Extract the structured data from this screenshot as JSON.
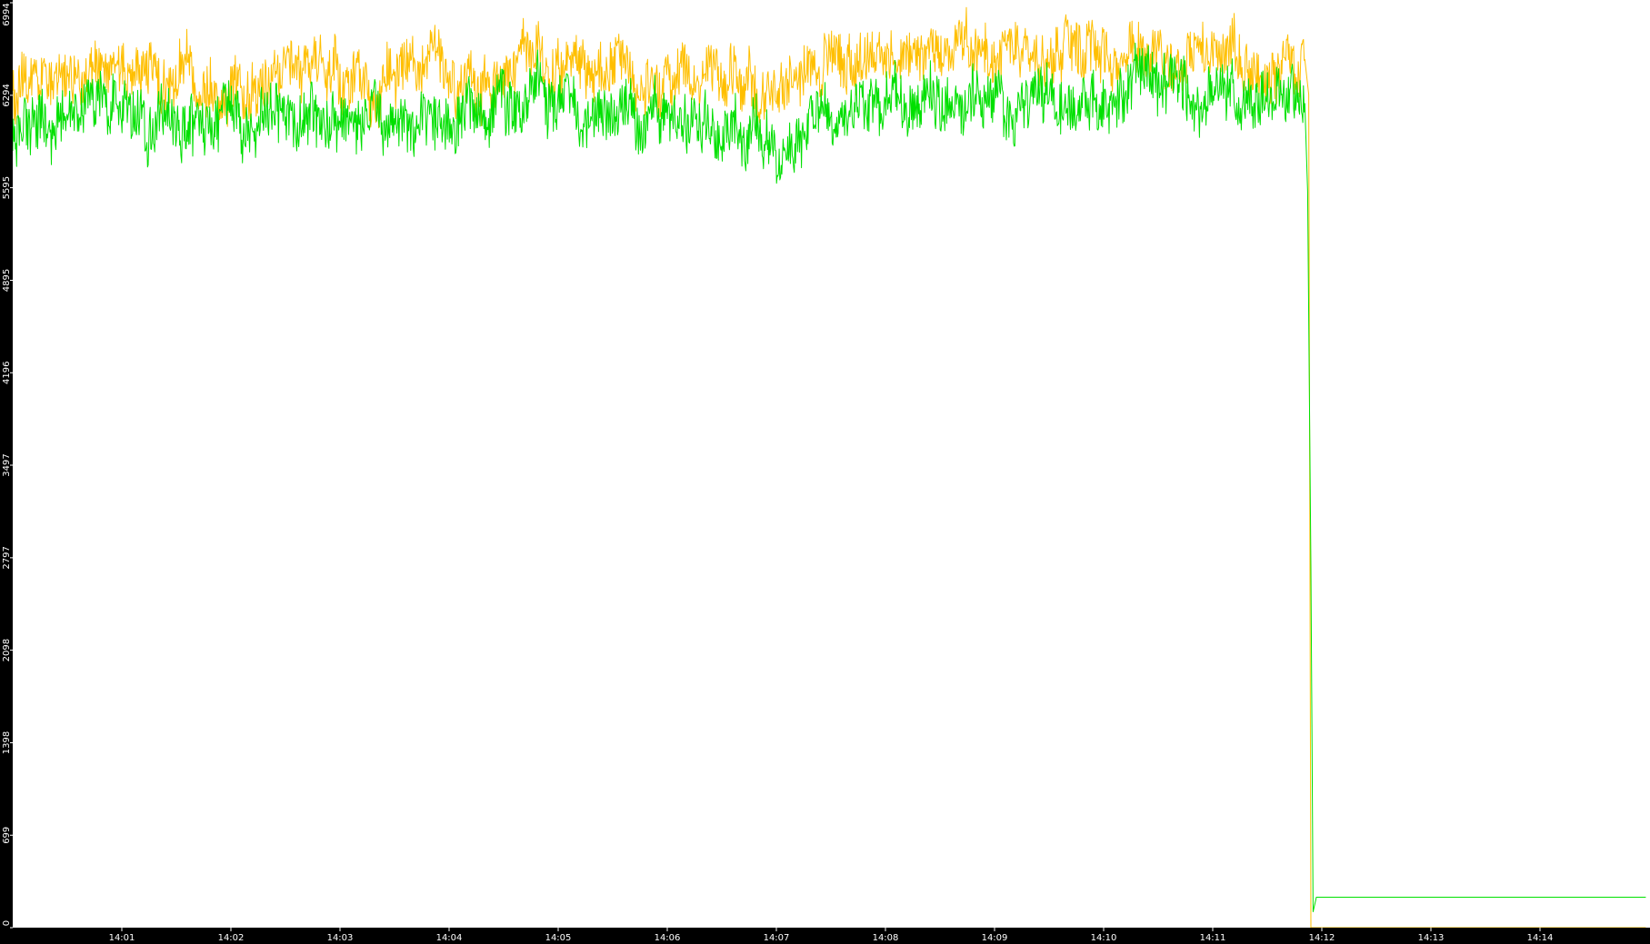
{
  "chart_data": {
    "type": "line",
    "title": "",
    "xlabel": "",
    "ylabel": "",
    "y_ticks": [
      "0",
      "699",
      "1398",
      "2098",
      "2797",
      "3497",
      "4196",
      "4895",
      "5595",
      "6294",
      "6994"
    ],
    "x_ticks": [
      "14:01",
      "14:02",
      "14:03",
      "14:04",
      "14:05",
      "14:06",
      "14:07",
      "14:08",
      "14:09",
      "14:10",
      "14:11",
      "14:12",
      "14:13",
      "14:14"
    ],
    "ylim": [
      0,
      6994
    ],
    "x_range_minutes": [
      0.0,
      14.97
    ],
    "grid": false,
    "legend": "none",
    "colors": {
      "background": "#ffffff",
      "axis_band": "#000000",
      "tick_text": "#ffffff",
      "series_orange": "#ffbf00",
      "series_green": "#00e000"
    },
    "series": [
      {
        "key": "orange",
        "color": "#ffbf00",
        "points": [
          [
            0.0,
            6300
          ],
          [
            0.5,
            6460
          ],
          [
            1.0,
            6480
          ],
          [
            1.5,
            6420
          ],
          [
            2.0,
            6430
          ],
          [
            2.5,
            6480
          ],
          [
            3.0,
            6400
          ],
          [
            3.5,
            6470
          ],
          [
            4.0,
            6380
          ],
          [
            4.5,
            6470
          ],
          [
            4.8,
            6600
          ],
          [
            5.0,
            6480
          ],
          [
            5.5,
            6460
          ],
          [
            6.0,
            6390
          ],
          [
            6.5,
            6420
          ],
          [
            6.9,
            6300
          ],
          [
            7.0,
            6350
          ],
          [
            7.5,
            6470
          ],
          [
            8.0,
            6650
          ],
          [
            8.5,
            6620
          ],
          [
            9.0,
            6580
          ],
          [
            9.5,
            6620
          ],
          [
            10.0,
            6650
          ],
          [
            10.5,
            6640
          ],
          [
            11.0,
            6580
          ],
          [
            11.5,
            6520
          ],
          [
            11.85,
            6520
          ],
          [
            11.88,
            6300
          ],
          [
            11.9,
            0
          ],
          [
            14.97,
            0
          ]
        ],
        "noise_amplitude": 190
      },
      {
        "key": "green",
        "color": "#00e000",
        "points": [
          [
            0.0,
            6050
          ],
          [
            0.5,
            6180
          ],
          [
            1.0,
            6200
          ],
          [
            1.5,
            6150
          ],
          [
            2.0,
            6130
          ],
          [
            2.5,
            6160
          ],
          [
            3.0,
            6100
          ],
          [
            3.5,
            6130
          ],
          [
            4.0,
            6030
          ],
          [
            4.5,
            6140
          ],
          [
            4.8,
            6300
          ],
          [
            5.0,
            6200
          ],
          [
            5.5,
            6170
          ],
          [
            6.0,
            6080
          ],
          [
            6.5,
            6080
          ],
          [
            6.9,
            5900
          ],
          [
            7.0,
            6000
          ],
          [
            7.5,
            6150
          ],
          [
            8.0,
            6290
          ],
          [
            8.5,
            6240
          ],
          [
            9.0,
            6200
          ],
          [
            9.5,
            6240
          ],
          [
            10.0,
            6300
          ],
          [
            10.5,
            6330
          ],
          [
            11.0,
            6270
          ],
          [
            11.5,
            6250
          ],
          [
            11.85,
            6200
          ],
          [
            11.87,
            5570
          ],
          [
            11.9,
            2720
          ],
          [
            11.92,
            120
          ],
          [
            11.95,
            230
          ],
          [
            14.97,
            230
          ]
        ],
        "noise_amplitude": 200
      }
    ]
  }
}
